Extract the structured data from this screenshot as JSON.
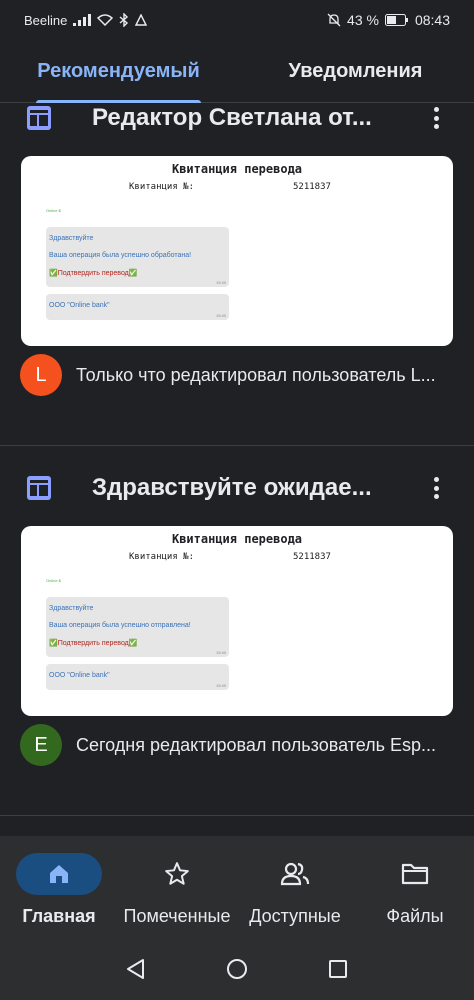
{
  "status": {
    "carrier": "Beeline",
    "battery": "43 %",
    "time": "08:43"
  },
  "tabs": [
    {
      "label": "Рекомендуемый",
      "active": true
    },
    {
      "label": "Уведомления",
      "active": false
    }
  ],
  "cards": [
    {
      "title": "Редактор Светлана от...",
      "preview": {
        "heading": "Квитанция перевода",
        "receipt_label": "Квитанция №:",
        "receipt_number": "5211837",
        "tiny": "Online $",
        "greeting": "Здравствуйте",
        "message": "Ваша операция была успешно обработана!",
        "confirm": "✅Подтвердить перевод✅",
        "org": "ООО \"Online bank\"",
        "time": "19:40"
      },
      "avatar_letter": "L",
      "avatar_color": "#f4511e",
      "meta": "Только что редактировал пользователь L..."
    },
    {
      "title": "Здравствуйте ожидае...",
      "preview": {
        "heading": "Квитанция перевода",
        "receipt_label": "Квитанция №:",
        "receipt_number": "5211837",
        "tiny": "Online $",
        "greeting": "Здравствуйте",
        "message": "Ваша операция была успешно отправлена!",
        "confirm": "✅Подтвердить перевод✅",
        "org": "ООО \"Online bank\"",
        "time": "19:40"
      },
      "avatar_letter": "E",
      "avatar_color": "#33691e",
      "meta": "Сегодня редактировал пользователь Esp..."
    }
  ],
  "bottom_nav": [
    {
      "label": "Главная",
      "icon": "home-icon",
      "active": true
    },
    {
      "label": "Помеченные",
      "icon": "star-icon",
      "active": false
    },
    {
      "label": "Доступные",
      "icon": "people-icon",
      "active": false
    },
    {
      "label": "Файлы",
      "icon": "folder-icon",
      "active": false
    }
  ],
  "colors": {
    "accent": "#8ab4f8",
    "background": "#202124",
    "doc_icon": "#8c9eff"
  }
}
